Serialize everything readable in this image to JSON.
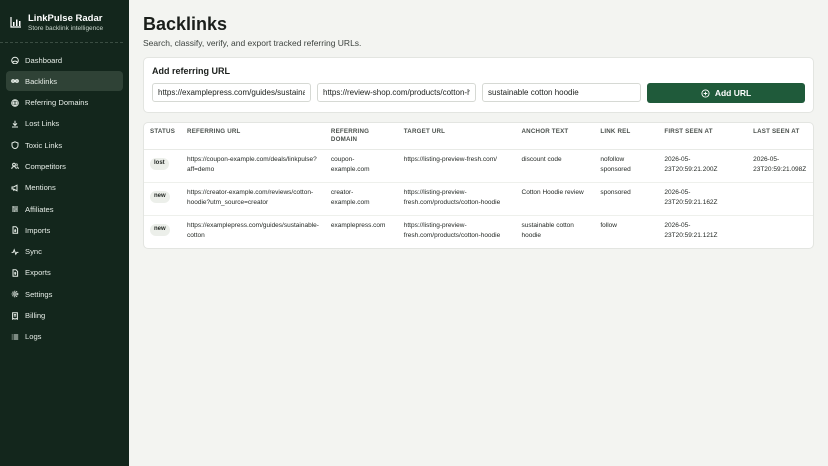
{
  "app": {
    "name": "LinkPulse Radar",
    "tagline": "Store backlink intelligence"
  },
  "sidebar": {
    "items": [
      {
        "label": "Dashboard",
        "icon": "dashboard-icon"
      },
      {
        "label": "Backlinks",
        "icon": "link-icon",
        "active": true
      },
      {
        "label": "Referring Domains",
        "icon": "globe-icon"
      },
      {
        "label": "Lost Links",
        "icon": "download-icon"
      },
      {
        "label": "Toxic Links",
        "icon": "shield-icon"
      },
      {
        "label": "Competitors",
        "icon": "people-icon"
      },
      {
        "label": "Mentions",
        "icon": "megaphone-icon"
      },
      {
        "label": "Affiliates",
        "icon": "sliders-icon"
      },
      {
        "label": "Imports",
        "icon": "file-import-icon"
      },
      {
        "label": "Sync",
        "icon": "pulse-icon"
      },
      {
        "label": "Exports",
        "icon": "file-export-icon"
      },
      {
        "label": "Settings",
        "icon": "gear-icon"
      },
      {
        "label": "Billing",
        "icon": "receipt-icon"
      },
      {
        "label": "Logs",
        "icon": "list-icon"
      }
    ]
  },
  "page": {
    "title": "Backlinks",
    "subtitle": "Search, classify, verify, and export tracked referring URLs."
  },
  "add_form": {
    "title": "Add referring URL",
    "referring_url": "https://examplepress.com/guides/sustainable-cotton",
    "target_url": "https://review-shop.com/products/cotton-hoodie",
    "anchor_text": "sustainable cotton hoodie",
    "button_label": "Add URL"
  },
  "table": {
    "headers": [
      "STATUS",
      "REFERRING URL",
      "REFERRING DOMAIN",
      "TARGET URL",
      "ANCHOR TEXT",
      "LINK REL",
      "FIRST SEEN AT",
      "LAST SEEN AT"
    ],
    "rows": [
      {
        "status": "lost",
        "referring_url": "https://coupon-example.com/deals/linkpulse?aff=demo",
        "referring_domain": "coupon-example.com",
        "target_url": "https://listing-preview-fresh.com/",
        "anchor_text": "discount code",
        "link_rel": "nofollow sponsored",
        "first_seen": "2026-05-23T20:59:21.200Z",
        "last_seen": "2026-05-23T20:59:21.098Z"
      },
      {
        "status": "new",
        "referring_url": "https://creator-example.com/reviews/cotton-hoodie?utm_source=creator",
        "referring_domain": "creator-example.com",
        "target_url": "https://listing-preview-fresh.com/products/cotton-hoodie",
        "anchor_text": "Cotton Hoodie review",
        "link_rel": "sponsored",
        "first_seen": "2026-05-23T20:59:21.162Z",
        "last_seen": ""
      },
      {
        "status": "new",
        "referring_url": "https://examplepress.com/guides/sustainable-cotton",
        "referring_domain": "examplepress.com",
        "target_url": "https://listing-preview-fresh.com/products/cotton-hoodie",
        "anchor_text": "sustainable cotton hoodie",
        "link_rel": "follow",
        "first_seen": "2026-05-23T20:59:21.121Z",
        "last_seen": ""
      }
    ]
  }
}
